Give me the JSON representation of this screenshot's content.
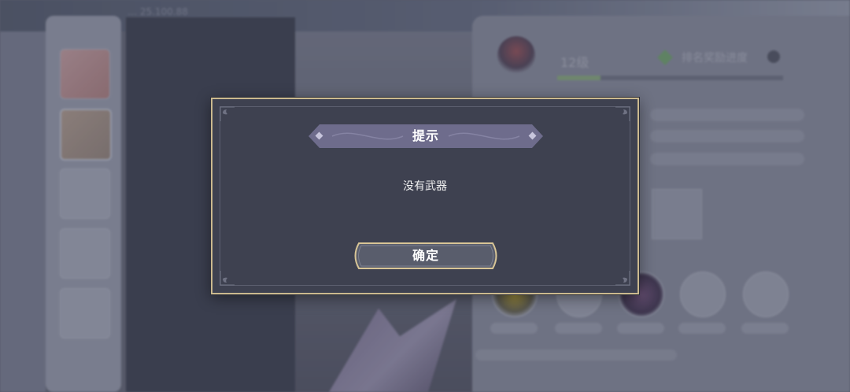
{
  "background": {
    "top_label": "…  25.100.88",
    "level_text": "12级",
    "rank_text": "排名奖励进度",
    "exp_progress": 0.19
  },
  "dialog": {
    "title": "提示",
    "message": "没有武器",
    "confirm_label": "确定"
  },
  "colors": {
    "dialog_bg": "#3e4150",
    "dialog_border": "#cbb98e",
    "banner_bg": "#6e6c8c",
    "button_bg": "#595d6c"
  }
}
